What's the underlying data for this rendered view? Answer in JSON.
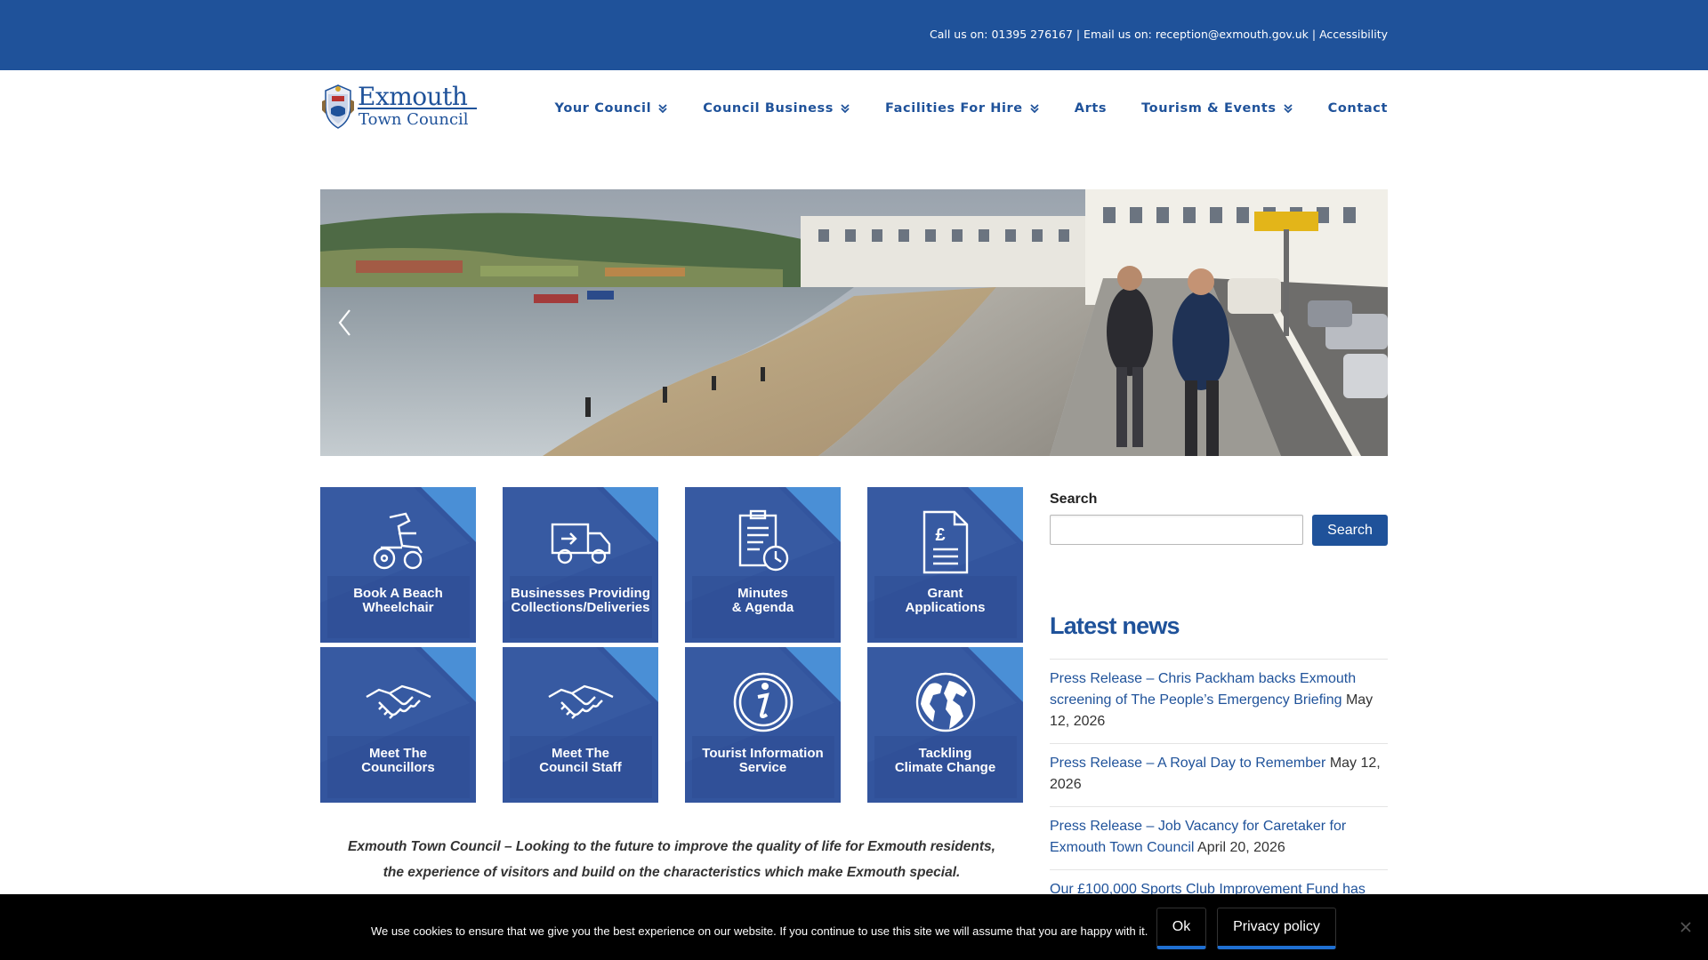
{
  "topbar": {
    "contact_line": "Call us on: 01395 276167 | Email us on: reception@exmouth.gov.uk | Accessibility"
  },
  "logo": {
    "line1": "Exmouth",
    "line2": "Town Council"
  },
  "nav": {
    "items": [
      {
        "label": "Your Council",
        "has_dropdown": true
      },
      {
        "label": "Council Business",
        "has_dropdown": true
      },
      {
        "label": "Facilities For Hire",
        "has_dropdown": true
      },
      {
        "label": "Arts",
        "has_dropdown": false
      },
      {
        "label": "Tourism & Events",
        "has_dropdown": true
      },
      {
        "label": "Contact",
        "has_dropdown": false
      }
    ]
  },
  "hero": {
    "prev_icon": "chevron-left-icon"
  },
  "tiles": [
    {
      "label": "Book A Beach\nWheelchair",
      "icon": "wheelchair-icon"
    },
    {
      "label": "Businesses Providing\nCollections/Deliveries",
      "icon": "delivery-van-icon"
    },
    {
      "label": "Minutes\n& Agenda",
      "icon": "clipboard-clock-icon"
    },
    {
      "label": "Grant\nApplications",
      "icon": "pound-document-icon"
    },
    {
      "label": "Meet The\nCouncillors",
      "icon": "handshake-icon"
    },
    {
      "label": "Meet The\nCouncil Staff",
      "icon": "handshake-icon"
    },
    {
      "label": "Tourist Information\nService",
      "icon": "info-icon"
    },
    {
      "label": "Tackling\nClimate Change",
      "icon": "globe-icon"
    }
  ],
  "mission": "Exmouth Town Council – Looking to the future to improve the quality of life for Exmouth residents, the experience of visitors and build on the characteristics which make Exmouth special.",
  "sidebar": {
    "search_label": "Search",
    "search_placeholder": "",
    "search_button": "Search",
    "news_title": "Latest news",
    "news": [
      {
        "title": "Press Release – Chris Packham backs Exmouth screening of The People’s Emergency Briefing",
        "date": "May 12, 2026"
      },
      {
        "title": "Press Release – A Royal Day to Remember",
        "date": "May 12, 2026"
      },
      {
        "title": "Press Release – Job Vacancy for Caretaker for Exmouth Town Council",
        "date": "April 20, 2026"
      },
      {
        "title": "Our £100,000 Sports Club Improvement Fund has",
        "date": ""
      }
    ]
  },
  "cookie": {
    "text": "We use cookies to ensure that we give you the best experience on our website. If you continue to use this site we will assume that you are happy with it.",
    "ok_label": "Ok",
    "privacy_label": "Privacy policy"
  },
  "colors": {
    "brand_blue": "#1f529a",
    "tile_blue": "#33559e",
    "tile_corner": "#4a8fd6",
    "cookie_bg": "#000000"
  }
}
